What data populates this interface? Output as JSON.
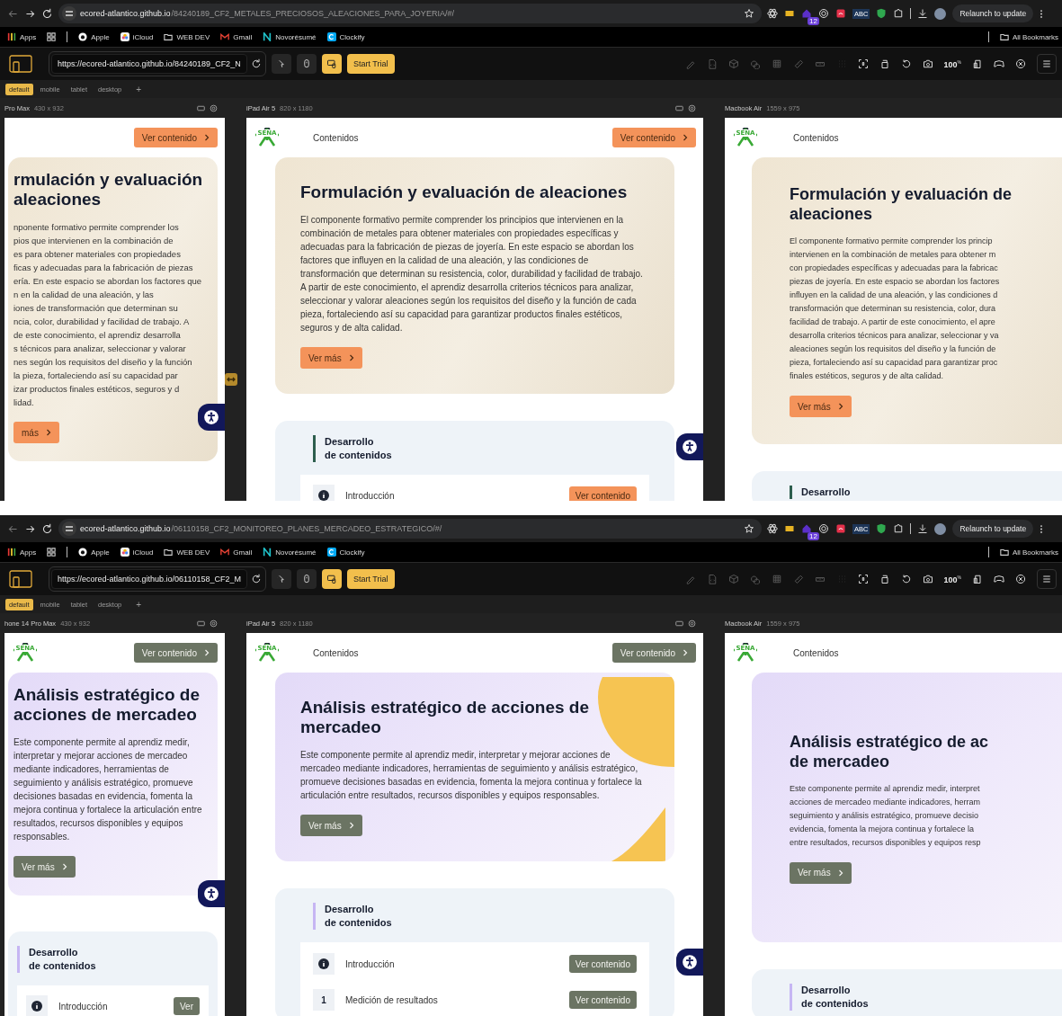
{
  "windows": [
    {
      "kind": "warm",
      "address": {
        "host": "ecored-atlantico.github.io",
        "path": "/84240189_CF2_METALES_PRECIOSOS_ALEACIONES_PARA_JOYERIA/#/"
      },
      "extension_badge": "12",
      "extension_label": "ABC",
      "relaunch": "Relaunch to update",
      "bookmarks": [
        {
          "kind": "apps",
          "label": "Apps"
        },
        {
          "kind": "apple",
          "label": "Apple"
        },
        {
          "kind": "icloud",
          "label": "iCloud"
        },
        {
          "kind": "folder",
          "label": "WEB DEV"
        },
        {
          "kind": "gmail",
          "label": "Gmail"
        },
        {
          "kind": "novo",
          "label": "Novorésumé"
        },
        {
          "kind": "clockify",
          "label": "Clockify"
        }
      ],
      "all_bookmarks": "All Bookmarks",
      "viewer": {
        "url": "https://ecored-atlantico.github.io/84240189_CF2_N",
        "start_trial": "Start Trial",
        "zoom": "100",
        "zoom_unit": "%",
        "add_tab": "+",
        "tabs": [
          {
            "label": "default",
            "selected": true
          },
          {
            "label": "mobile",
            "selected": false
          },
          {
            "label": "tablet",
            "selected": false
          },
          {
            "label": "desktop",
            "selected": false
          }
        ]
      },
      "resize_handle": true,
      "panes": [
        {
          "kind": "mobile",
          "device": "Pro Max",
          "size": "430 x 932",
          "page": {
            "cta": "Ver contenido",
            "accessibility_button": true,
            "hero": {
              "title_lines": [
                "rmulación y evaluación",
                "aleaciones"
              ],
              "button": "más",
              "text_lines": [
                "nponente formativo permite comprender los",
                "pios que intervienen en la combinación de",
                "es para obtener materiales con propiedades",
                "ficas y adecuadas para la fabricación de piezas",
                "ería. En este espacio se abordan los factores que",
                "n en la calidad de una aleación, y las",
                "iones de transformación que determinan su",
                "ncia, color, durabilidad y facilidad de trabajo. A",
                "de este conocimiento, el aprendiz desarrolla",
                "s técnicos para analizar, seleccionar y valorar",
                "nes según los requisitos del diseño y la función",
                "la pieza, fortaleciendo así su capacidad par",
                "izar productos finales estéticos, seguros y d",
                "lidad."
              ]
            }
          }
        },
        {
          "kind": "tablet",
          "device": "iPad Air 5",
          "size": "820 x 1180",
          "page": {
            "logo": "SENA",
            "nav": "Contenidos",
            "cta": "Ver contenido",
            "accessibility_button": true,
            "hero": {
              "title_lines": [
                "Formulación y evaluación de aleaciones"
              ],
              "button": "Ver más",
              "text": "El componente formativo permite comprender los principios que intervienen en la combinación de metales para obtener materiales con propiedades específicas y adecuadas para la fabricación de piezas de joyería. En este espacio se abordan los factores que influyen en la calidad de una aleación, y las condiciones de transformación que determinan su resistencia, color, durabilidad y facilidad de trabajo. A partir de este conocimiento, el aprendiz desarrolla criterios técnicos para analizar, seleccionar y valorar aleaciones según los requisitos del diseño y la función de cada pieza, fortaleciendo así su capacidad para garantizar productos finales estéticos, seguros y de alta calidad."
            },
            "dev": {
              "title_lines": [
                "Desarrollo",
                "de contenidos"
              ],
              "items": [
                {
                  "kind": "info",
                  "label": "Introducción",
                  "button": "Ver contenido"
                }
              ]
            }
          }
        },
        {
          "kind": "desktop",
          "device": "Macbook Air",
          "size": "1559 x 975",
          "page": {
            "logo": "SENA",
            "nav": "Contenidos",
            "hero": {
              "title_lines": [
                "Formulación y evaluación de",
                "aleaciones"
              ],
              "button": "Ver más",
              "text_lines": [
                "El componente formativo permite comprender los princip",
                "intervienen en la combinación de metales para obtener m",
                "con propiedades específicas y adecuadas para la fabricac",
                "piezas de joyería. En este espacio se abordan los factores",
                "influyen en la calidad de una aleación, y las condiciones d",
                "transformación que determinan su resistencia, color, dura",
                "facilidad de trabajo. A partir de este conocimiento, el apre",
                "desarrolla criterios técnicos para analizar, seleccionar y va",
                "aleaciones según los requisitos del diseño y la función de",
                "pieza, fortaleciendo así su capacidad para garantizar proc",
                "finales estéticos, seguros y de alta calidad."
              ]
            },
            "dev": {
              "title_lines": [
                "Desarrollo"
              ]
            }
          }
        }
      ]
    },
    {
      "kind": "lavender",
      "address": {
        "host": "ecored-atlantico.github.io",
        "path": "/06110158_CF2_MONITOREO_PLANES_MERCADEO_ESTRATEGICO/#/"
      },
      "extension_badge": "12",
      "extension_label": "ABC",
      "relaunch": "Relaunch to update",
      "bookmarks": [
        {
          "kind": "apps",
          "label": "Apps"
        },
        {
          "kind": "apple",
          "label": "Apple"
        },
        {
          "kind": "icloud",
          "label": "iCloud"
        },
        {
          "kind": "folder",
          "label": "WEB DEV"
        },
        {
          "kind": "gmail",
          "label": "Gmail"
        },
        {
          "kind": "novo",
          "label": "Novorésumé"
        },
        {
          "kind": "clockify",
          "label": "Clockify"
        }
      ],
      "all_bookmarks": "All Bookmarks",
      "viewer": {
        "url": "https://ecored-atlantico.github.io/06110158_CF2_M",
        "start_trial": "Start Trial",
        "zoom": "100",
        "zoom_unit": "%",
        "add_tab": "+",
        "tabs": [
          {
            "label": "default",
            "selected": true
          },
          {
            "label": "mobile",
            "selected": false
          },
          {
            "label": "tablet",
            "selected": false
          },
          {
            "label": "desktop",
            "selected": false
          }
        ]
      },
      "panes": [
        {
          "kind": "mobile",
          "device": "hone 14 Pro Max",
          "size": "430 x 932",
          "page": {
            "logo": "SENA",
            "cta": "Ver contenido",
            "accessibility_button": true,
            "hero": {
              "title_lines": [
                "Análisis estratégico de",
                "acciones de mercadeo"
              ],
              "button": "Ver más",
              "text": "Este componente permite al aprendiz medir, interpretar y mejorar acciones de mercadeo mediante indicadores, herramientas de seguimiento y análisis estratégico, promueve decisiones basadas en evidencia, fomenta la mejora continua y fortalece la articulación entre resultados, recursos disponibles y equipos responsables."
            },
            "dev": {
              "title_lines": [
                "Desarrollo",
                "de contenidos"
              ],
              "items": [
                {
                  "kind": "info",
                  "label": "Introducción",
                  "button": "Ver"
                }
              ]
            }
          }
        },
        {
          "kind": "tablet",
          "device": "iPad Air 5",
          "size": "820 x 1180",
          "page": {
            "logo": "SENA",
            "nav": "Contenidos",
            "cta": "Ver contenido",
            "accessibility_button": true,
            "blobs": true,
            "hero": {
              "title_lines": [
                "Análisis estratégico de acciones de",
                "mercadeo"
              ],
              "button": "Ver más",
              "text": "Este componente permite al aprendiz medir, interpretar y mejorar acciones de mercadeo mediante indicadores, herramientas de seguimiento y análisis estratégico, promueve decisiones basadas en evidencia, fomenta la mejora continua y fortalece la articulación entre resultados, recursos disponibles y equipos responsables."
            },
            "dev": {
              "title_lines": [
                "Desarrollo",
                "de contenidos"
              ],
              "items": [
                {
                  "kind": "info",
                  "label": "Introducción",
                  "button": "Ver contenido"
                },
                {
                  "kind": "number",
                  "number": "1",
                  "label": "Medición de resultados",
                  "button": "Ver contenido"
                }
              ]
            }
          }
        },
        {
          "kind": "desktop",
          "device": "Macbook Air",
          "size": "1559 x 975",
          "page": {
            "logo": "SENA",
            "nav": "Contenidos",
            "hero": {
              "title_lines": [
                "Análisis estratégico de ac",
                "de mercadeo"
              ],
              "button": "Ver más",
              "text_lines": [
                "Este componente permite al aprendiz medir, interpret",
                "acciones de mercadeo mediante indicadores, herram",
                "seguimiento y análisis estratégico, promueve decisio",
                "evidencia, fomenta la mejora continua y fortalece la",
                "entre resultados, recursos disponibles y equipos resp"
              ]
            },
            "dev": {
              "title_lines": [
                "Desarrollo",
                "de contenidos"
              ]
            }
          }
        }
      ]
    }
  ]
}
